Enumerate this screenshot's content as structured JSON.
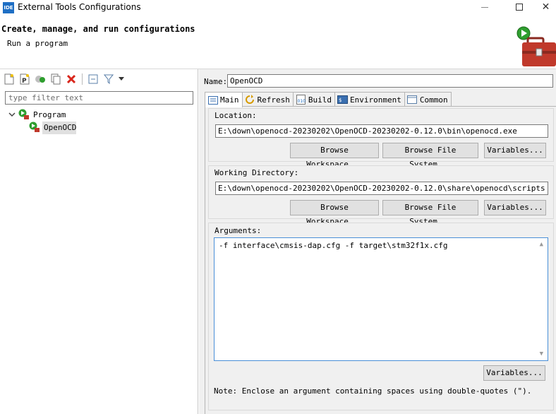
{
  "window": {
    "app_icon_text": "IDE",
    "title": "External Tools Configurations"
  },
  "header": {
    "title": "Create, manage, and run configurations",
    "message": "Run a program"
  },
  "left": {
    "filter_placeholder": "type filter text",
    "tree": [
      {
        "label": "Program",
        "expanded": true
      },
      {
        "label": "OpenOCD",
        "selected": true
      }
    ]
  },
  "right": {
    "name_label": "Name:",
    "name_value": "OpenOCD",
    "tabs": [
      {
        "label": "Main",
        "active": true
      },
      {
        "label": "Refresh"
      },
      {
        "label": "Build"
      },
      {
        "label": "Environment"
      },
      {
        "label": "Common"
      }
    ],
    "location": {
      "label": "Location:",
      "value": "E:\\down\\openocd-20230202\\OpenOCD-20230202-0.12.0\\bin\\openocd.exe",
      "browse_workspace": "Browse Workspace...",
      "browse_file_system": "Browse File System...",
      "variables": "Variables..."
    },
    "working_directory": {
      "label": "Working Directory:",
      "value": "E:\\down\\openocd-20230202\\OpenOCD-20230202-0.12.0\\share\\openocd\\scripts",
      "browse_workspace": "Browse Workspace...",
      "browse_file_system": "Browse File System...",
      "variables": "Variables..."
    },
    "arguments": {
      "label": "Arguments:",
      "value": "-f interface\\cmsis-dap.cfg -f target\\stm32f1x.cfg",
      "variables": "Variables...",
      "note": "Note: Enclose an argument containing spaces using double-quotes (\")."
    }
  },
  "colors": {
    "accent_blue": "#1f6fc4",
    "run_green": "#2e9e2e",
    "toolbox_red": "#c0392b"
  }
}
